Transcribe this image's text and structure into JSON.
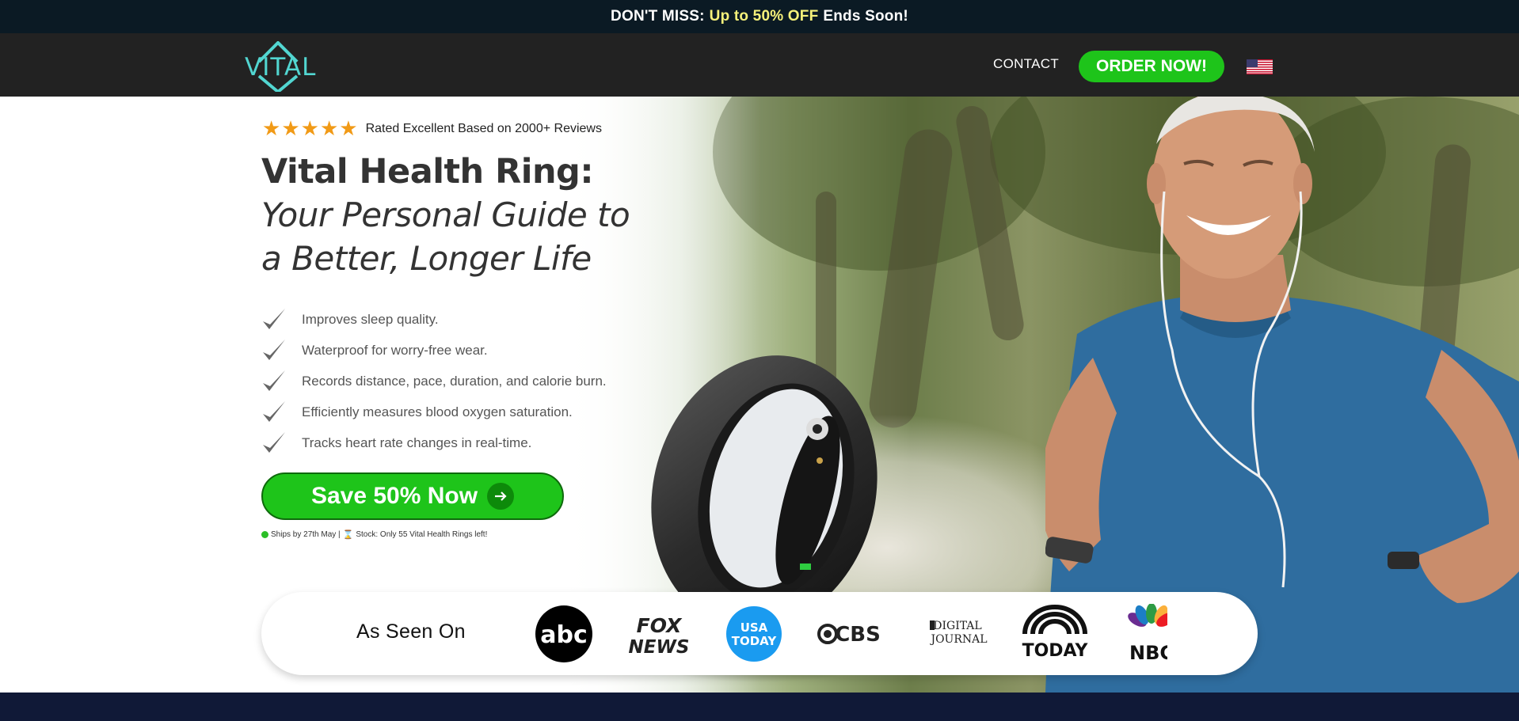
{
  "promo": {
    "prefix": "DON'T MISS:",
    "highlight": "Up to 50% OFF",
    "suffix": "Ends Soon!"
  },
  "header": {
    "logo_text": "VITAL",
    "contact_label": "CONTACT",
    "order_label": "ORDER NOW!",
    "flag_icon": "us-flag-icon"
  },
  "hero": {
    "rating_text": "Rated Excellent Based on 2000+ Reviews",
    "stars": 5,
    "title_line1": "Vital Health Ring:",
    "title_line2": "Your Personal Guide to a Better, Longer Life",
    "features": [
      "Improves sleep quality.",
      "Waterproof for worry-free wear.",
      "Records distance, pace, duration, and calorie burn.",
      "Efficiently measures blood oxygen saturation.",
      "Tracks heart rate changes in real-time."
    ],
    "cta_label": "Save 50% Now",
    "ship_text": "Ships by 27th May |",
    "stock_text": "Stock: Only 55 Vital Health Rings left!"
  },
  "seen_on": {
    "label": "As Seen On",
    "logos": [
      "abc",
      "FOX NEWS",
      "USA TODAY",
      "CBS",
      "DIGITAL JOURNAL",
      "TODAY",
      "NBC"
    ]
  },
  "colors": {
    "accent_green": "#1ec41a",
    "promo_bg": "#0b1a24",
    "header_bg": "#222222",
    "highlight_yellow": "#f6f17a",
    "logo_teal": "#52d6d1",
    "star_orange": "#f19a16"
  }
}
